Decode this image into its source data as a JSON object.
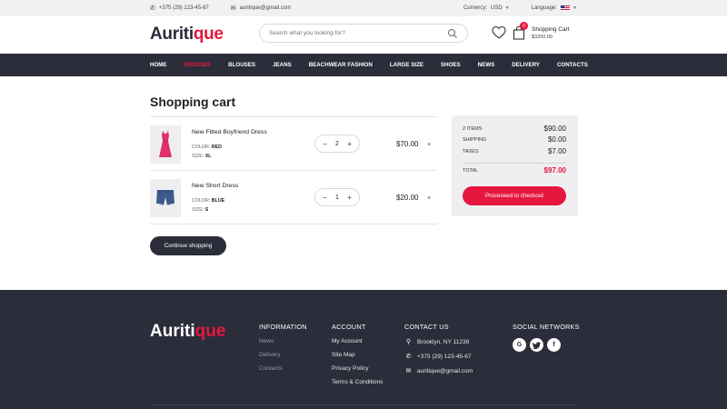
{
  "topbar": {
    "phone": "+375 (29) 123-45-67",
    "email": "auritique@gmail.com",
    "currency_label": "Currency:",
    "currency_value": "USD",
    "language_label": "Language:"
  },
  "header": {
    "logo_main": "Auriti",
    "logo_accent": "que",
    "search_placeholder": "Search what you looking for?",
    "cart_count": "0",
    "cart_title": "Shopping Cart",
    "cart_amount": "$3200.00"
  },
  "nav": {
    "items": [
      "HOME",
      "DRESSES",
      "BLOUSES",
      "JEANS",
      "BEACHWEAR FASHION",
      "LARGE SIZE",
      "SHOES",
      "NEWS",
      "DELIVERY",
      "CONTACTS"
    ],
    "active_index": 1
  },
  "cart": {
    "title": "Shopping cart",
    "items": [
      {
        "name": "New Fitted Boyfriend Dress",
        "color_label": "COLOR:",
        "color": "RED",
        "size_label": "SIZE:",
        "size": "XL",
        "qty": "2",
        "price": "$70.00",
        "remove": "×"
      },
      {
        "name": "New Short Dress",
        "color_label": "COLOR:",
        "color": "BLUE",
        "size_label": "SIZE:",
        "size": "S",
        "qty": "1",
        "price": "$20.00",
        "remove": "×"
      }
    ],
    "continue_label": "Continue shopping"
  },
  "summary": {
    "items_label": "2 ITEMS",
    "items_value": "$90.00",
    "shipping_label": "SHIPPING",
    "shipping_value": "$0.00",
    "taxes_label": "TAXES",
    "taxes_value": "$7.00",
    "total_label": "TOTAL",
    "total_value": "$97.00",
    "checkout_label": "Proceseed to checkout"
  },
  "footer": {
    "logo_main": "Auriti",
    "logo_accent": "que",
    "information": {
      "title": "INFORMATION",
      "links": [
        "News",
        "Delivery",
        "Contacts"
      ]
    },
    "account": {
      "title": "ACCOUNT",
      "links": [
        "My Account",
        "Site Map",
        "Privacy Policy",
        "Terms & Conditions"
      ]
    },
    "contact": {
      "title": "CONTACT US",
      "address": "Brooklyn, NY 11238",
      "phone": "+375 (29) 123-45-67",
      "email": "auritique@gmail.com"
    },
    "social": {
      "title": "SOCIAL NETWORKS",
      "icons": [
        "google-plus-icon",
        "twitter-icon",
        "facebook-icon"
      ]
    }
  },
  "colors": {
    "accent": "#e5173f",
    "dark": "#2b2d3a",
    "panel": "#efeff1"
  }
}
